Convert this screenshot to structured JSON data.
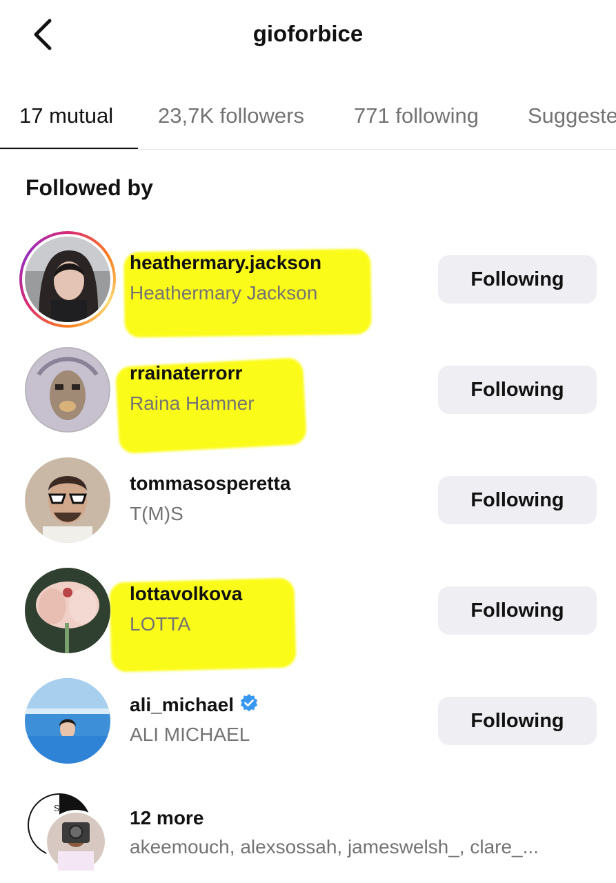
{
  "header": {
    "title": "gioforbice",
    "back_icon": "chevron-left-icon"
  },
  "tabs": [
    {
      "label": "17 mutual",
      "active": true
    },
    {
      "label": "23,7K followers",
      "active": false
    },
    {
      "label": "771 following",
      "active": false
    },
    {
      "label": "Suggested",
      "active": false
    }
  ],
  "section_title": "Followed by",
  "users": [
    {
      "username": "heathermary.jackson",
      "full_name": "Heathermary Jackson",
      "button": "Following",
      "has_story": true,
      "highlighted": true,
      "verified": false
    },
    {
      "username": "rrainaterrorr",
      "full_name": "Raina Hamner",
      "button": "Following",
      "has_story": false,
      "highlighted": true,
      "verified": false
    },
    {
      "username": "tommasosperetta",
      "full_name": "T(M)S",
      "button": "Following",
      "has_story": false,
      "highlighted": false,
      "verified": false
    },
    {
      "username": "lottavolkova",
      "full_name": "LOTTA",
      "button": "Following",
      "has_story": false,
      "highlighted": true,
      "verified": false
    },
    {
      "username": "ali_michael",
      "full_name": "ALI MICHAEL",
      "button": "Following",
      "has_story": false,
      "highlighted": false,
      "verified": true
    }
  ],
  "more": {
    "title": "12 more",
    "names": "akeemouch, alexsossah, jameswelsh_, clare_..."
  },
  "colors": {
    "highlight": "#fbfb1a",
    "button_bg": "#efeff3",
    "verified": "#3897f0",
    "secondary_text": "#737373"
  }
}
